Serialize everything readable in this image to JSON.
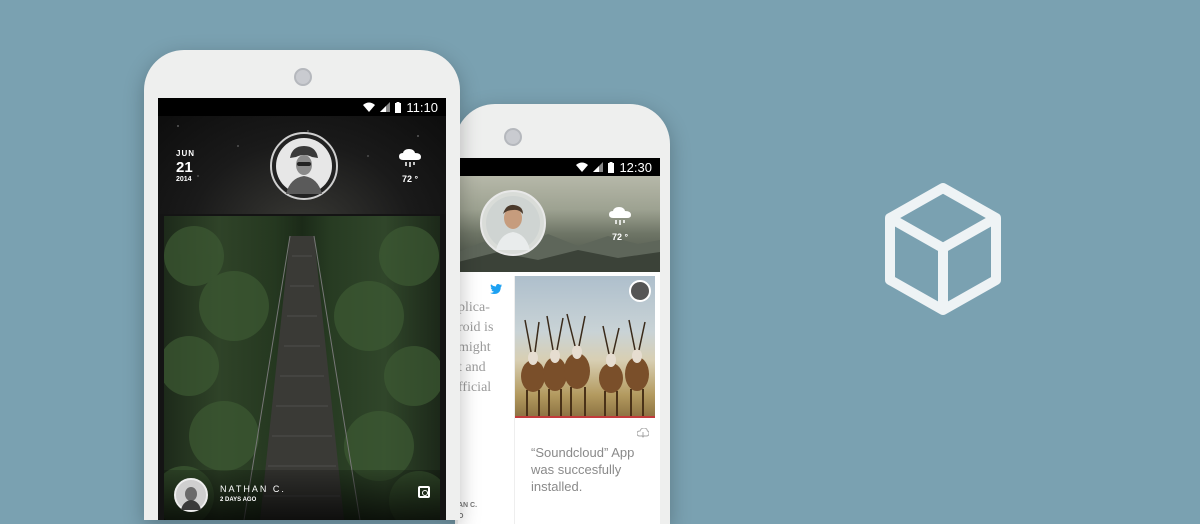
{
  "phone1": {
    "status": {
      "time": "11:10"
    },
    "date": {
      "month": "JUN",
      "day": "21",
      "year": "2014"
    },
    "weather": {
      "temp": "72 °",
      "icon": "rain-cloud-icon"
    },
    "post": {
      "author": "NATHAN C.",
      "time_ago": "2 DAYS AGO",
      "source_icon": "instagram-icon"
    }
  },
  "phone2": {
    "status": {
      "time": "12:30"
    },
    "weather": {
      "temp": "72 °",
      "icon": "rain-cloud-icon"
    },
    "twitter_card": {
      "lines": [
        "",
        "plica-",
        "roid is",
        "might",
        "t and",
        "fficial"
      ],
      "footer": [
        "AN C.",
        "O"
      ]
    },
    "soundcloud_card": {
      "text": "“Soundcloud” App was succesfully installed."
    }
  },
  "colors": {
    "background": "#7aa1b1",
    "accent_red": "#c23b3b",
    "twitter": "#1da1f2"
  }
}
